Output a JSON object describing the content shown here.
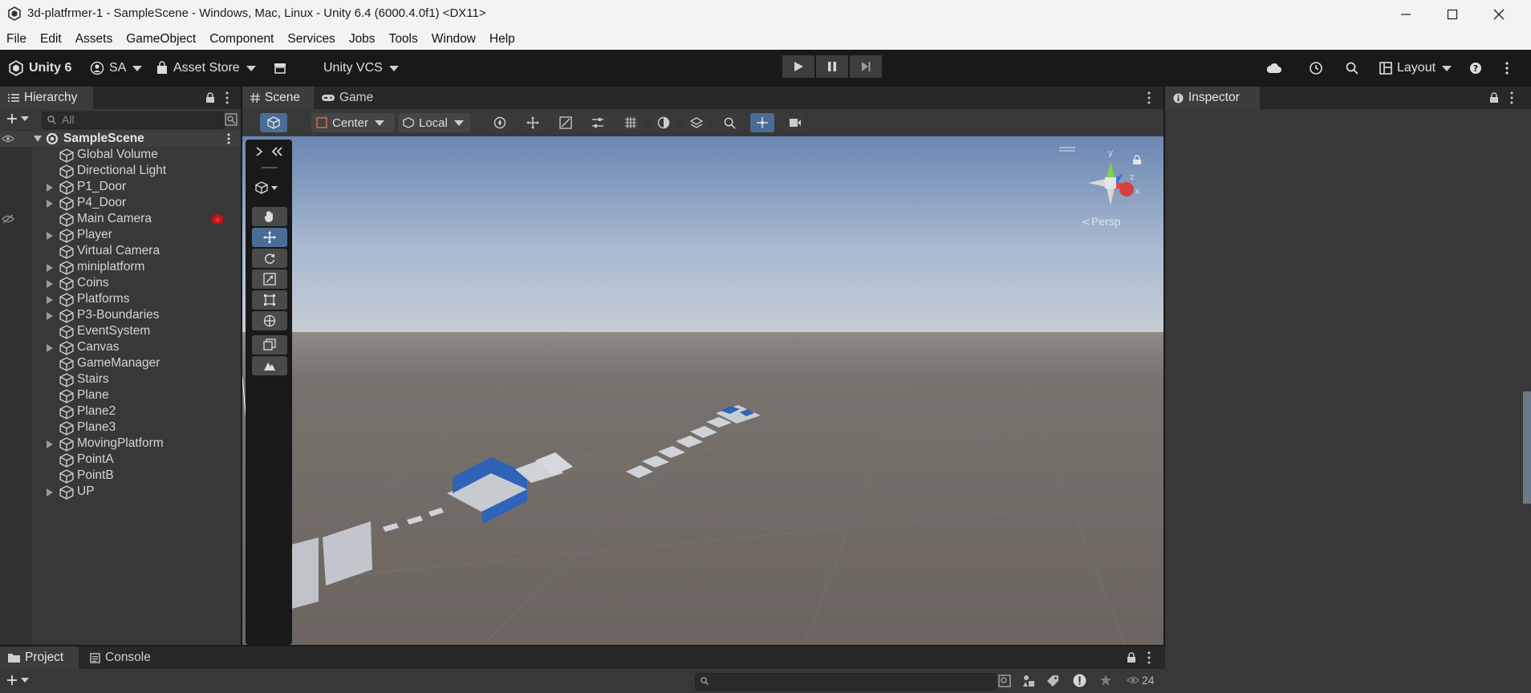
{
  "window": {
    "title": "3d-platfrmer-1 - SampleScene - Windows, Mac, Linux - Unity 6.4 (6000.4.0f1) <DX11>",
    "controls": [
      "minimize-icon",
      "maximize-icon",
      "close-icon"
    ]
  },
  "menu": [
    "File",
    "Edit",
    "Assets",
    "GameObject",
    "Component",
    "Services",
    "Jobs",
    "Tools",
    "Window",
    "Help"
  ],
  "toolbar": {
    "unity_label": "Unity 6",
    "account_label": "SA",
    "asset_store_label": "Asset Store",
    "vcs_label": "Unity VCS",
    "layout_label": "Layout"
  },
  "hierarchy": {
    "tab_label": "Hierarchy",
    "search_placeholder": "All",
    "scene_name": "SampleScene",
    "items": [
      {
        "label": "Global Volume",
        "expandable": false
      },
      {
        "label": "Directional Light",
        "expandable": false
      },
      {
        "label": "P1_Door",
        "expandable": true
      },
      {
        "label": "P4_Door",
        "expandable": true
      },
      {
        "label": "Main Camera",
        "expandable": false
      },
      {
        "label": "Player",
        "expandable": true
      },
      {
        "label": "Virtual Camera",
        "expandable": false
      },
      {
        "label": "miniplatform",
        "expandable": true
      },
      {
        "label": "Coins",
        "expandable": true
      },
      {
        "label": "Platforms",
        "expandable": true
      },
      {
        "label": "P3-Boundaries",
        "expandable": true
      },
      {
        "label": "EventSystem",
        "expandable": false
      },
      {
        "label": "Canvas",
        "expandable": true
      },
      {
        "label": "GameManager",
        "expandable": false
      },
      {
        "label": "Stairs",
        "expandable": false
      },
      {
        "label": "Plane",
        "expandable": false
      },
      {
        "label": "Plane2",
        "expandable": false
      },
      {
        "label": "Plane3",
        "expandable": false
      },
      {
        "label": "MovingPlatform",
        "expandable": true
      },
      {
        "label": "PointA",
        "expandable": false
      },
      {
        "label": "PointB",
        "expandable": false
      },
      {
        "label": "UP",
        "expandable": true
      }
    ]
  },
  "scene": {
    "tabs": [
      "Scene",
      "Game"
    ],
    "pivot_label": "Center",
    "space_label": "Local",
    "gizmo_persp_label": "Persp",
    "axis_labels": [
      "y",
      "z",
      "x"
    ]
  },
  "inspector": {
    "tab_label": "Inspector"
  },
  "bottom": {
    "tabs": [
      "Project",
      "Console"
    ],
    "hidden_count": "24"
  },
  "colors": {
    "accent": "#3a72b0",
    "panel": "#383838",
    "dark": "#191919",
    "sky_top": "#6a88b4",
    "ground": "#706a66"
  }
}
